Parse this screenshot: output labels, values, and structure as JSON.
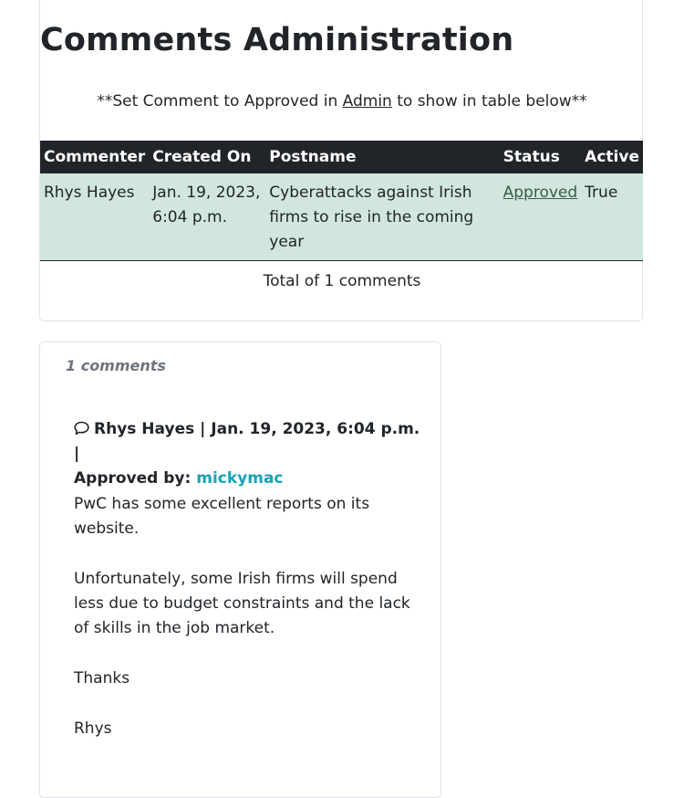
{
  "admin": {
    "title": "Comments Administration",
    "note_prefix": "**Set Comment to Approved in ",
    "note_link": "Admin",
    "note_suffix": " to show in table below**",
    "columns": [
      "Commenter",
      "Created On",
      "Postname",
      "Status",
      "Active"
    ],
    "rows": [
      {
        "commenter": "Rhys Hayes",
        "created_on": "Jan. 19, 2023, 6:04 p.m.",
        "postname": "Cyberattacks against Irish firms to rise in the coming year",
        "status": "Approved",
        "active": "True"
      }
    ],
    "total": "Total of 1 comments",
    "colors": {
      "header_bg": "#212529",
      "row_bg": "#d1e7dd"
    }
  },
  "comments": {
    "count": "1 comments",
    "icon": "comment-icon",
    "author": "Rhys Hayes",
    "date": "Jan. 19, 2023, 6:04 p.m.",
    "approved_label": "Approved by:",
    "approver": "mickymac",
    "paragraphs": [
      "PwC has some excellent reports on its website.",
      "Unfortunately, some Irish firms will spend less due to budget constraints and the lack of skills in the job market.",
      "Thanks",
      "Rhys"
    ],
    "colors": {
      "approver": "#17a2b8",
      "count": "#6c757d"
    }
  }
}
